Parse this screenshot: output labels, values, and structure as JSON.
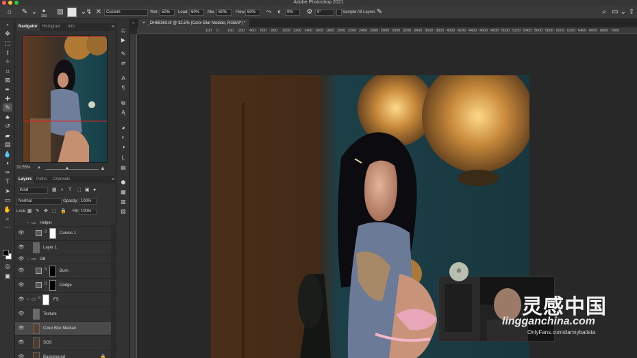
{
  "app": {
    "title": "Adobe Photoshop 2021"
  },
  "options_bar": {
    "brush_size": "200",
    "mode": "Custom",
    "wet_label": "Wet:",
    "wet_value": "50%",
    "load_label": "Load:",
    "load_value": "60%",
    "mix_label": "Mix:",
    "mix_value": "60%",
    "flow_label": "Flow:",
    "flow_value": "60%",
    "angle_value": "0%",
    "smoothing_value": "0°",
    "sample_all_layers": "Sample All Layers"
  },
  "panels": {
    "navigator_tabs": [
      "Navigator",
      "Histogram",
      "Info"
    ],
    "navigator_zoom": "32.55%",
    "layers_tabs": [
      "Layers",
      "Paths",
      "Channels"
    ],
    "filter_kind": "Kind",
    "blend_mode": "Normal",
    "opacity_label": "Opacity:",
    "opacity_value": "100%",
    "lock_label": "Lock:",
    "fill_label": "Fill:",
    "fill_value": "100%"
  },
  "layers": [
    {
      "name": "Helper",
      "kind": "group"
    },
    {
      "name": "Curves 1",
      "kind": "adjustment"
    },
    {
      "name": "Layer 1",
      "kind": "pixel"
    },
    {
      "name": "DB",
      "kind": "group"
    },
    {
      "name": "Burn",
      "kind": "adjustment"
    },
    {
      "name": "Dodge",
      "kind": "adjustment"
    },
    {
      "name": "FS",
      "kind": "group"
    },
    {
      "name": "Texture",
      "kind": "pixel"
    },
    {
      "name": "Color Blur Median",
      "kind": "pixel",
      "selected": true
    },
    {
      "name": "SOS",
      "kind": "pixel"
    },
    {
      "name": "Background",
      "kind": "pixel"
    }
  ],
  "document": {
    "tab_title": "_DH88363.tif @ 32.5% (Color Blur Median, RGB/8*) *",
    "ruler_ticks": [
      "100",
      "0",
      "100",
      "200",
      "400",
      "600",
      "800",
      "1000",
      "1200",
      "1400",
      "1600",
      "1800",
      "2000",
      "2200",
      "2400",
      "2600",
      "2800",
      "3000",
      "3200",
      "3400",
      "3600",
      "3800",
      "4000",
      "4200",
      "4400",
      "4600",
      "4800",
      "5000",
      "5200",
      "5400",
      "5600",
      "5800",
      "6000",
      "6200",
      "6400",
      "6600",
      "6800",
      "7000"
    ]
  },
  "watermark": {
    "chinese": "灵感中国",
    "site": "lingganchina.com",
    "url": "OnlyFans.com/dannybatista"
  },
  "colors": {
    "chrome_dark": "#323232",
    "selected_layer": "#4a4a4a",
    "teal_wall": "#1f4d55"
  }
}
